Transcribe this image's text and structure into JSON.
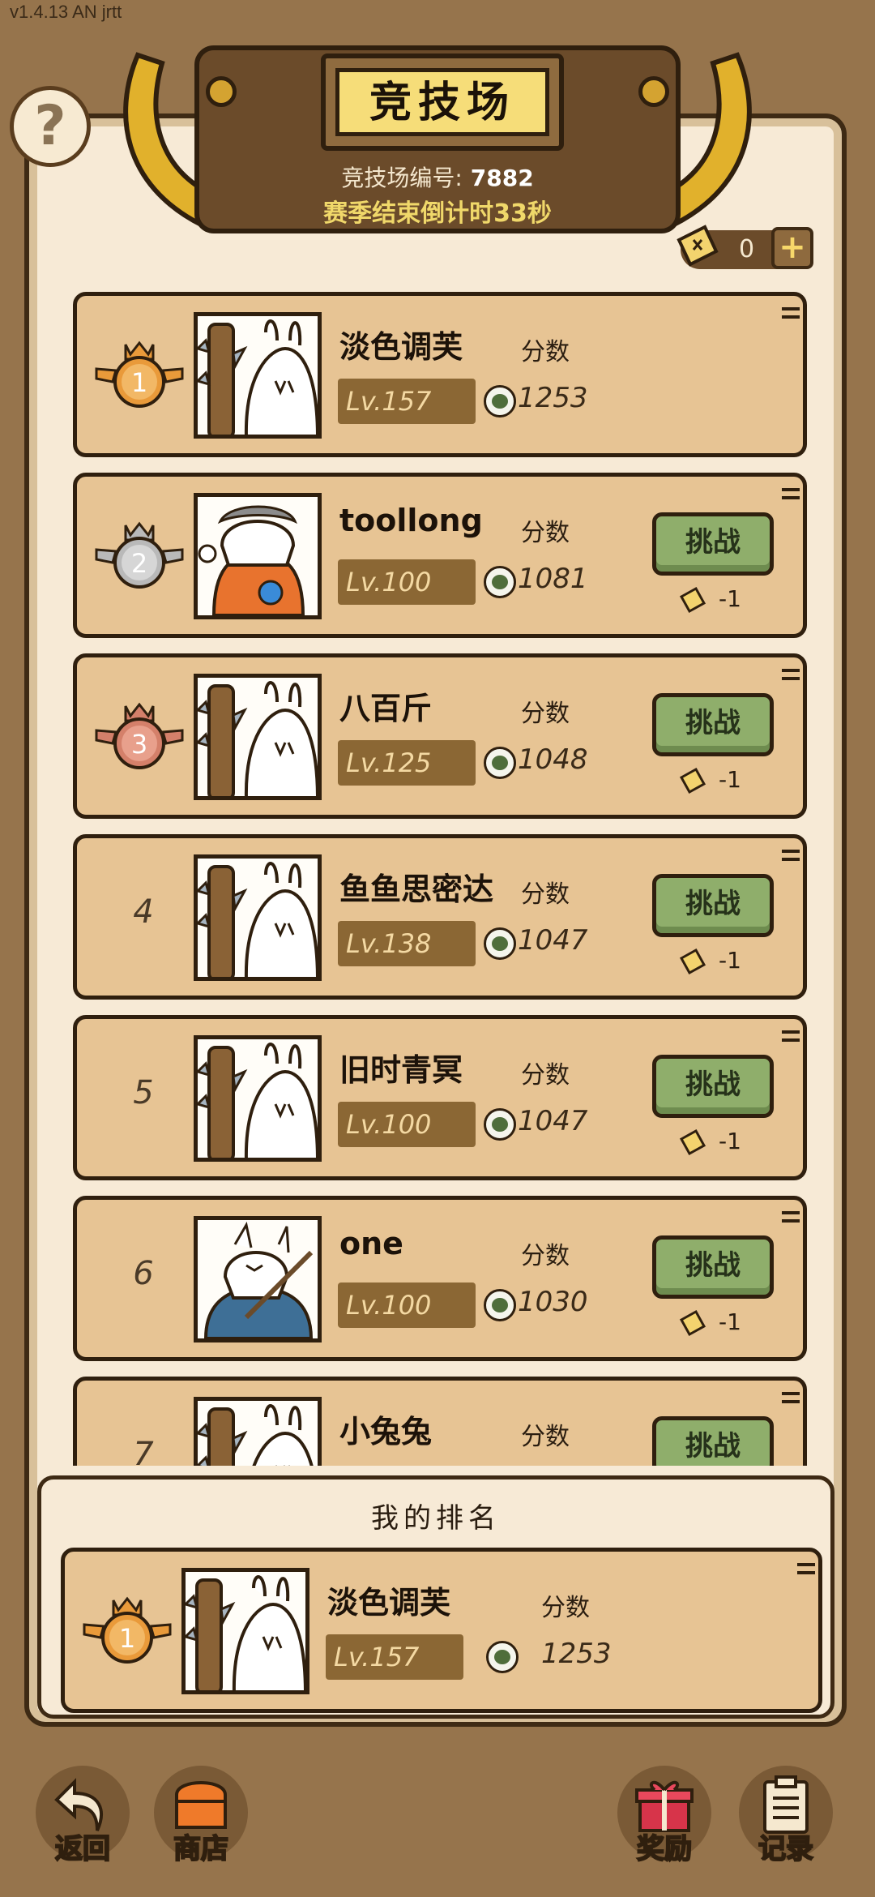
{
  "version": "v1.4.13 AN jrtt",
  "help": {
    "label": "?"
  },
  "header": {
    "title": "竞技场",
    "arena_id_label": "竞技场编号:",
    "arena_id": "7882",
    "countdown": "赛季结束倒计时33秒"
  },
  "tickets": {
    "count": "0",
    "plus": "+"
  },
  "score_label": "分数",
  "challenge_label": "挑战",
  "cost_label": "-1",
  "ranking": [
    {
      "rank": "1",
      "name": "淡色调芙",
      "level": "Lv.157",
      "score": "1253",
      "avatar": "rabbit-with-club",
      "challenge": false
    },
    {
      "rank": "2",
      "name": "toollong",
      "level": "Lv.100",
      "score": "1081",
      "avatar": "rabbit-chef",
      "challenge": true
    },
    {
      "rank": "3",
      "name": "八百斤",
      "level": "Lv.125",
      "score": "1048",
      "avatar": "rabbit-with-club",
      "challenge": true
    },
    {
      "rank": "4",
      "name": "鱼鱼思密达",
      "level": "Lv.138",
      "score": "1047",
      "avatar": "rabbit-with-club",
      "challenge": true
    },
    {
      "rank": "5",
      "name": "旧时青冥",
      "level": "Lv.100",
      "score": "1047",
      "avatar": "rabbit-with-club",
      "challenge": true
    },
    {
      "rank": "6",
      "name": "one",
      "level": "Lv.100",
      "score": "1030",
      "avatar": "rabbit-archer",
      "challenge": true
    },
    {
      "rank": "7",
      "name": "小兔兔",
      "level": "",
      "score": "",
      "avatar": "rabbit-with-club",
      "challenge": true
    }
  ],
  "my_ranking": {
    "title": "我的排名",
    "rank": "1",
    "name": "淡色调芙",
    "level": "Lv.157",
    "score": "1253"
  },
  "bottom_nav": {
    "back": "返回",
    "shop": "商店",
    "rewards": "奖励",
    "records": "记录"
  },
  "colors": {
    "background": "#96744c",
    "panel": "#f7ead6",
    "row": "#e7c494",
    "challenge_button": "#8fae6b",
    "gold_medal": "#e99a3a",
    "silver_medal": "#b9b9b9",
    "bronze_medal": "#d4806a"
  }
}
